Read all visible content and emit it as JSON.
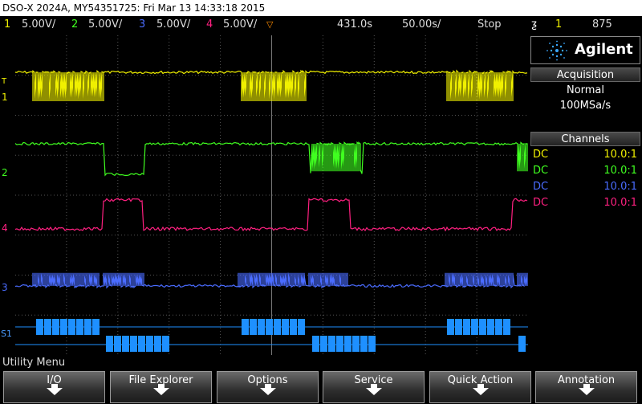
{
  "title": "DSO-X 2024A, MY54351725: Fri Mar 13 14:33:18 2015",
  "status": {
    "ch1_num": "1",
    "ch1_scale": "5.00V/",
    "ch2_num": "2",
    "ch2_scale": "5.00V/",
    "ch3_num": "3",
    "ch3_scale": "5.00V/",
    "ch4_num": "4",
    "ch4_scale": "5.00V/",
    "time_pos": "431.0s",
    "time_scale": "50.00s/",
    "run_state": "Stop",
    "trigger_source": "1",
    "trigger_level": "875"
  },
  "brand": {
    "name": "Agilent"
  },
  "acquisition": {
    "header": "Acquisition",
    "mode": "Normal",
    "rate": "100MSa/s"
  },
  "channels": {
    "header": "Channels",
    "rows": [
      {
        "coupling": "DC",
        "probe": "10.0:1",
        "color": "#f0f000"
      },
      {
        "coupling": "DC",
        "probe": "10.0:1",
        "color": "#40ff20"
      },
      {
        "coupling": "DC",
        "probe": "10.0:1",
        "color": "#4a6cff"
      },
      {
        "coupling": "DC",
        "probe": "10.0:1",
        "color": "#ff2080"
      }
    ]
  },
  "markers": {
    "ch1": "1",
    "ch2": "2",
    "ch3": "3",
    "ch4": "4",
    "serial": "S1",
    "trig": "T"
  },
  "menu": {
    "title": "Utility Menu",
    "softkeys": [
      "I/O",
      "File Explorer",
      "Options",
      "Service",
      "Quick Action",
      "Annotation"
    ]
  },
  "colors": {
    "ch1": "#f0f000",
    "ch2": "#40ff20",
    "ch3": "#4a6cff",
    "ch4": "#ff2080",
    "serial": "#1e90ff",
    "grid": "#555555"
  }
}
